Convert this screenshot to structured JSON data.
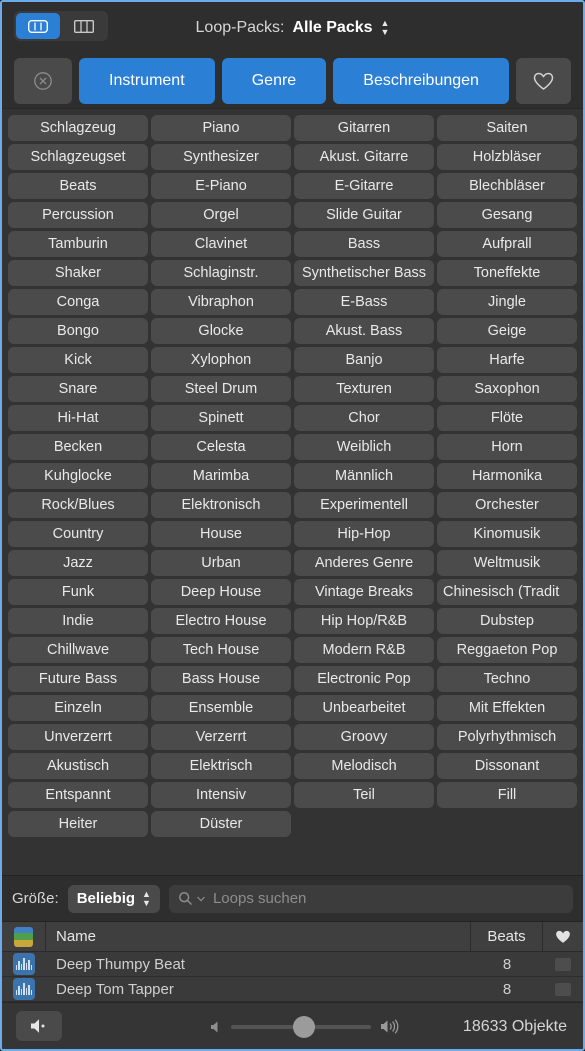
{
  "window": {
    "accent_blue": "#2b7fd4",
    "panel_bg": "#333333",
    "tag_bg": "#4b4b4b",
    "frame_border": "#6cacea"
  },
  "topbar": {
    "view_grid_icon": "grid-view-icon",
    "view_column_icon": "column-view-icon",
    "loop_packs_label": "Loop-Packs:",
    "loop_packs_value": "Alle Packs"
  },
  "filters": {
    "clear_icon": "clear-circle-x-icon",
    "buttons": [
      {
        "label": "Instrument",
        "style": "blue"
      },
      {
        "label": "Genre",
        "style": "blue"
      },
      {
        "label": "Beschreibungen",
        "style": "blue"
      }
    ],
    "favorite_icon": "heart-outline-icon"
  },
  "tags": [
    "Schlagzeug",
    "Piano",
    "Gitarren",
    "Saiten",
    "Schlagzeugset",
    "Synthesizer",
    "Akust. Gitarre",
    "Holzbläser",
    "Beats",
    "E-Piano",
    "E-Gitarre",
    "Blechbläser",
    "Percussion",
    "Orgel",
    "Slide Guitar",
    "Gesang",
    "Tamburin",
    "Clavinet",
    "Bass",
    "Aufprall",
    "Shaker",
    "Schlaginstr.",
    "Synthetischer Bass",
    "Toneffekte",
    "Conga",
    "Vibraphon",
    "E-Bass",
    "Jingle",
    "Bongo",
    "Glocke",
    "Akust. Bass",
    "Geige",
    "Kick",
    "Xylophon",
    "Banjo",
    "Harfe",
    "Snare",
    "Steel Drum",
    "Texturen",
    "Saxophon",
    "Hi-Hat",
    "Spinett",
    "Chor",
    "Flöte",
    "Becken",
    "Celesta",
    "Weiblich",
    "Horn",
    "Kuhglocke",
    "Marimba",
    "Männlich",
    "Harmonika",
    "Rock/Blues",
    "Elektronisch",
    "Experimentell",
    "Orchester",
    "Country",
    "House",
    "Hip-Hop",
    "Kinomusik",
    "Jazz",
    "Urban",
    "Anderes Genre",
    "Weltmusik",
    "Funk",
    "Deep House",
    "Vintage Breaks",
    "Chinesisch (Tradit",
    "Indie",
    "Electro House",
    "Hip Hop/R&B",
    "Dubstep",
    "Chillwave",
    "Tech House",
    "Modern R&B",
    "Reggaeton Pop",
    "Future Bass",
    "Bass House",
    "Electronic Pop",
    "Techno",
    "Einzeln",
    "Ensemble",
    "Unbearbeitet",
    "Mit Effekten",
    "Unverzerrt",
    "Verzerrt",
    "Groovy",
    "Polyrhythmisch",
    "Akustisch",
    "Elektrisch",
    "Melodisch",
    "Dissonant",
    "Entspannt",
    "Intensiv",
    "Teil",
    "Fill",
    "Heiter",
    "Düster",
    "",
    ""
  ],
  "clipped_tag_index": 67,
  "search": {
    "size_label": "Größe:",
    "size_value": "Beliebig",
    "search_icon": "magnifier-icon",
    "placeholder": "Loops suchen",
    "value": ""
  },
  "table": {
    "columns": [
      "",
      "Name",
      "Beats",
      ""
    ],
    "header_icon": "color-stripes-icon",
    "favorite_header_icon": "heart-filled-icon",
    "rows": [
      {
        "icon": "waveform-icon",
        "name": "Deep Thumpy Beat",
        "beats": "8",
        "favorite": false
      },
      {
        "icon": "waveform-icon",
        "name": "Deep Tom Tapper",
        "beats": "8",
        "favorite": false
      }
    ]
  },
  "footer": {
    "mute_icon": "speaker-mute-icon",
    "volume_low_icon": "volume-low-icon",
    "volume_high_icon": "volume-high-icon",
    "volume_percent": 45,
    "object_count": "18633 Objekte"
  }
}
